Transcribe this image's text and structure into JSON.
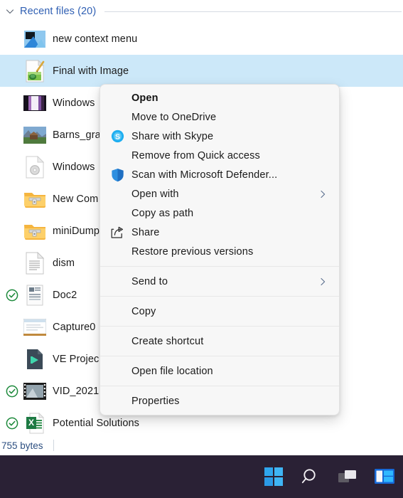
{
  "group": {
    "title": "Recent files (20)",
    "chevron_icon": "chevron-down-icon",
    "title_color": "#2f5fb3"
  },
  "files": [
    {
      "name": "new context menu",
      "icon": "image-thumbnail-icon",
      "sync": false,
      "selected": false
    },
    {
      "name": "Final with Image",
      "icon": "paint-document-icon",
      "sync": false,
      "selected": true
    },
    {
      "name": "Windows",
      "icon": "dark-photo-thumbnail-icon",
      "sync": false,
      "selected": false
    },
    {
      "name": "Barns_gra",
      "icon": "landscape-photo-icon",
      "sync": false,
      "selected": false
    },
    {
      "name": "Windows",
      "icon": "disc-image-file-icon",
      "sync": false,
      "selected": false
    },
    {
      "name": "New Com",
      "icon": "zipped-folder-icon",
      "sync": false,
      "selected": false
    },
    {
      "name": "miniDump",
      "icon": "zipped-folder-icon",
      "sync": false,
      "selected": false
    },
    {
      "name": "dism",
      "icon": "text-document-icon",
      "sync": false,
      "selected": false
    },
    {
      "name": "Doc2",
      "icon": "word-document-icon",
      "sync": true,
      "selected": false
    },
    {
      "name": "Capture0",
      "icon": "screenshot-thumbnail-icon",
      "sync": false,
      "selected": false
    },
    {
      "name": "VE Projec",
      "icon": "video-editor-file-icon",
      "sync": false,
      "selected": false
    },
    {
      "name": "VID_2021",
      "icon": "video-filmstrip-icon",
      "sync": true,
      "selected": false
    },
    {
      "name": "Potential Solutions",
      "icon": "excel-document-icon",
      "sync": true,
      "selected": false
    }
  ],
  "context_menu": {
    "items": [
      {
        "label": "Open",
        "icon": null,
        "bold": true,
        "submenu": false,
        "separator_after": false
      },
      {
        "label": "Move to OneDrive",
        "icon": null,
        "bold": false,
        "submenu": false,
        "separator_after": false
      },
      {
        "label": "Share with Skype",
        "icon": "skype-icon",
        "bold": false,
        "submenu": false,
        "separator_after": false
      },
      {
        "label": "Remove from Quick access",
        "icon": null,
        "bold": false,
        "submenu": false,
        "separator_after": false
      },
      {
        "label": "Scan with Microsoft Defender...",
        "icon": "defender-shield-icon",
        "bold": false,
        "submenu": false,
        "separator_after": false
      },
      {
        "label": "Open with",
        "icon": null,
        "bold": false,
        "submenu": true,
        "separator_after": false
      },
      {
        "label": "Copy as path",
        "icon": null,
        "bold": false,
        "submenu": false,
        "separator_after": false
      },
      {
        "label": "Share",
        "icon": "share-arrow-icon",
        "bold": false,
        "submenu": false,
        "separator_after": false
      },
      {
        "label": "Restore previous versions",
        "icon": null,
        "bold": false,
        "submenu": false,
        "separator_after": true
      },
      {
        "label": "Send to",
        "icon": null,
        "bold": false,
        "submenu": true,
        "separator_after": true
      },
      {
        "label": "Copy",
        "icon": null,
        "bold": false,
        "submenu": false,
        "separator_after": true
      },
      {
        "label": "Create shortcut",
        "icon": null,
        "bold": false,
        "submenu": false,
        "separator_after": true
      },
      {
        "label": "Open file location",
        "icon": null,
        "bold": false,
        "submenu": false,
        "separator_after": true
      },
      {
        "label": "Properties",
        "icon": null,
        "bold": false,
        "submenu": false,
        "separator_after": false
      }
    ]
  },
  "statusbar": {
    "text": "755 bytes"
  },
  "taskbar": {
    "background": "#2a2135",
    "buttons": [
      {
        "name": "start-button",
        "icon": "windows-logo-icon"
      },
      {
        "name": "search-button",
        "icon": "search-icon"
      },
      {
        "name": "task-view-button",
        "icon": "task-view-icon"
      },
      {
        "name": "file-explorer-button",
        "icon": "file-explorer-icon"
      }
    ]
  }
}
